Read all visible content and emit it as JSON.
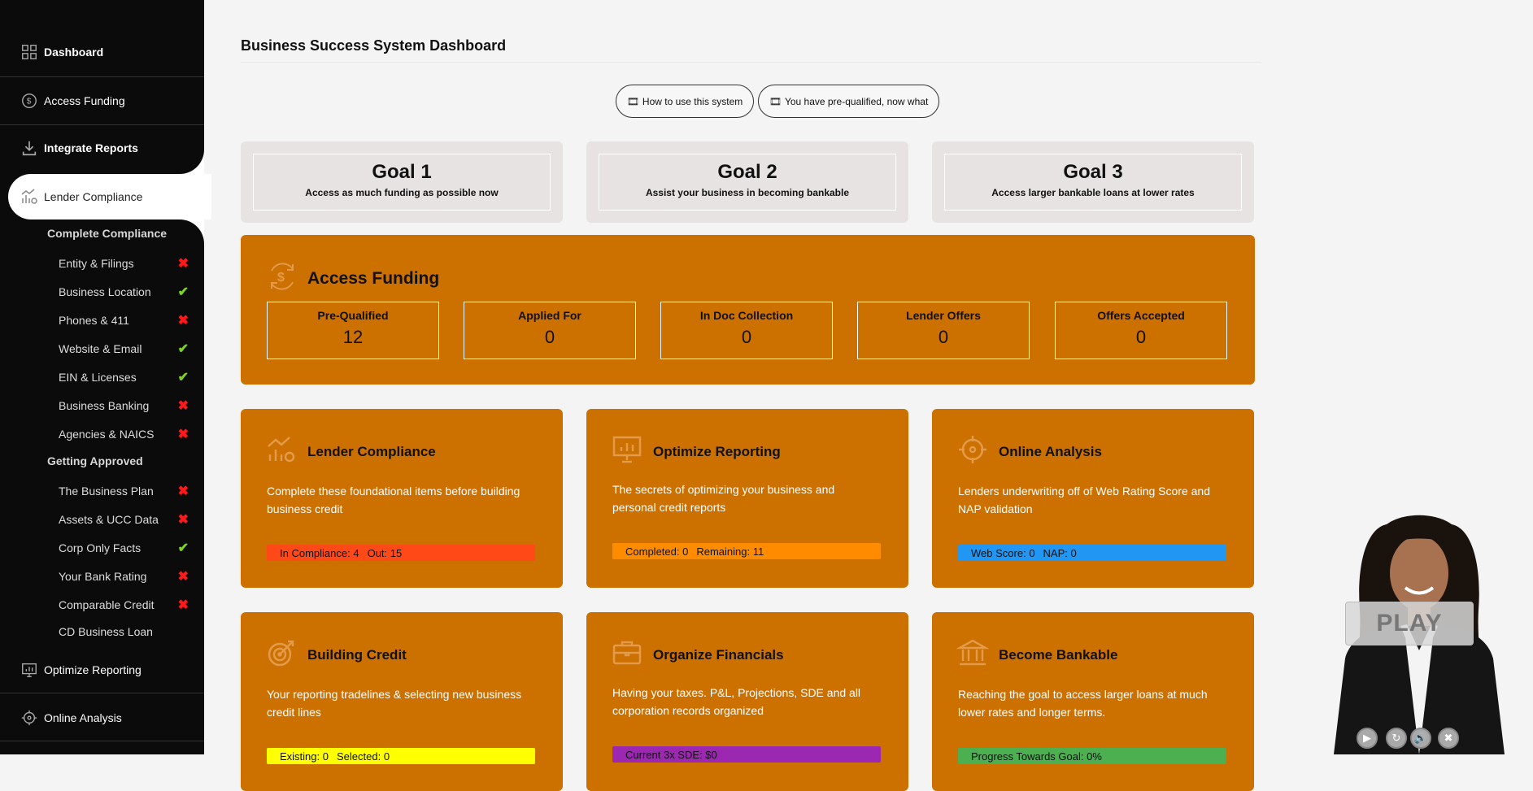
{
  "sidebar": {
    "dashboard": "Dashboard",
    "access_funding": "Access Funding",
    "integrate_reports": "Integrate Reports",
    "lender_compliance": "Lender Compliance",
    "complete_compliance": "Complete Compliance",
    "compliance_items": [
      {
        "label": "Entity & Filings",
        "status": "fail"
      },
      {
        "label": "Business Location",
        "status": "ok"
      },
      {
        "label": "Phones & 411",
        "status": "fail"
      },
      {
        "label": "Website & Email",
        "status": "ok"
      },
      {
        "label": "EIN & Licenses",
        "status": "ok"
      },
      {
        "label": "Business Banking",
        "status": "fail"
      },
      {
        "label": "Agencies & NAICS",
        "status": "fail"
      }
    ],
    "getting_approved": "Getting Approved",
    "approval_items": [
      {
        "label": "The Business Plan",
        "status": "fail"
      },
      {
        "label": "Assets & UCC Data",
        "status": "fail"
      },
      {
        "label": "Corp Only Facts",
        "status": "ok"
      },
      {
        "label": "Your Bank Rating",
        "status": "fail"
      },
      {
        "label": "Comparable Credit",
        "status": "fail"
      },
      {
        "label": "CD Business Loan",
        "status": "none"
      }
    ],
    "optimize_reporting": "Optimize Reporting",
    "online_analysis": "Online Analysis",
    "marks": {
      "fail": "✖",
      "ok": "✔"
    }
  },
  "header": {
    "title": "Business Success System Dashboard",
    "btn_how": "How to use this system",
    "btn_prequal": "You have pre-qualified, now what",
    "film_icon": "🎞"
  },
  "goals": [
    {
      "title": "Goal 1",
      "subtitle": "Access as much funding as possible now"
    },
    {
      "title": "Goal 2",
      "subtitle": "Assist your business in becoming bankable"
    },
    {
      "title": "Goal 3",
      "subtitle": "Access larger bankable loans at lower rates"
    }
  ],
  "access_funding": {
    "title": "Access Funding",
    "stats": [
      {
        "label": "Pre-Qualified",
        "value": "12"
      },
      {
        "label": "Applied For",
        "value": "0"
      },
      {
        "label": "In Doc Collection",
        "value": "0"
      },
      {
        "label": "Lender Offers",
        "value": "0"
      },
      {
        "label": "Offers Accepted",
        "value": "0"
      }
    ]
  },
  "cards": [
    {
      "title": "Lender Compliance",
      "desc": "Complete these foundational items before building business credit",
      "bar_a_label": "In Compliance:",
      "bar_a_val": "4",
      "bar_b_label": "Out:",
      "bar_b_val": "15",
      "bar_color": "#ff4a17"
    },
    {
      "title": "Optimize Reporting",
      "desc": "The secrets of optimizing your business and personal credit reports",
      "bar_a_label": "Completed:",
      "bar_a_val": "0",
      "bar_b_label": "Remaining:",
      "bar_b_val": "11",
      "bar_color": "#ff8c00"
    },
    {
      "title": "Online Analysis",
      "desc": "Lenders underwriting off of Web Rating Score and NAP validation",
      "bar_a_label": "Web Score:",
      "bar_a_val": "0",
      "bar_b_label": "NAP:",
      "bar_b_val": "0",
      "bar_color": "#2196f3"
    },
    {
      "title": "Building Credit",
      "desc": "Your reporting tradelines & selecting new business credit lines",
      "bar_a_label": "Existing:",
      "bar_a_val": "0",
      "bar_b_label": "Selected:",
      "bar_b_val": "0",
      "bar_color": "#ffff00"
    },
    {
      "title": "Organize Financials",
      "desc": "Having your taxes. P&L, Projections, SDE and all corporation records organized",
      "bar_a_label": "Current 3x SDE:",
      "bar_a_val": "$0",
      "bar_b_label": "",
      "bar_b_val": "",
      "bar_color": "#9c27b0"
    },
    {
      "title": "Become Bankable",
      "desc": "Reaching the goal to access larger loans at much lower rates and longer terms.",
      "bar_a_label": "Progress Towards Goal:",
      "bar_a_val": "0%",
      "bar_b_label": "",
      "bar_b_val": "",
      "bar_color": "#4caf50"
    }
  ],
  "video": {
    "play_label": "PLAY",
    "controls": [
      "▶",
      "↻",
      "🔊",
      "✖"
    ]
  }
}
